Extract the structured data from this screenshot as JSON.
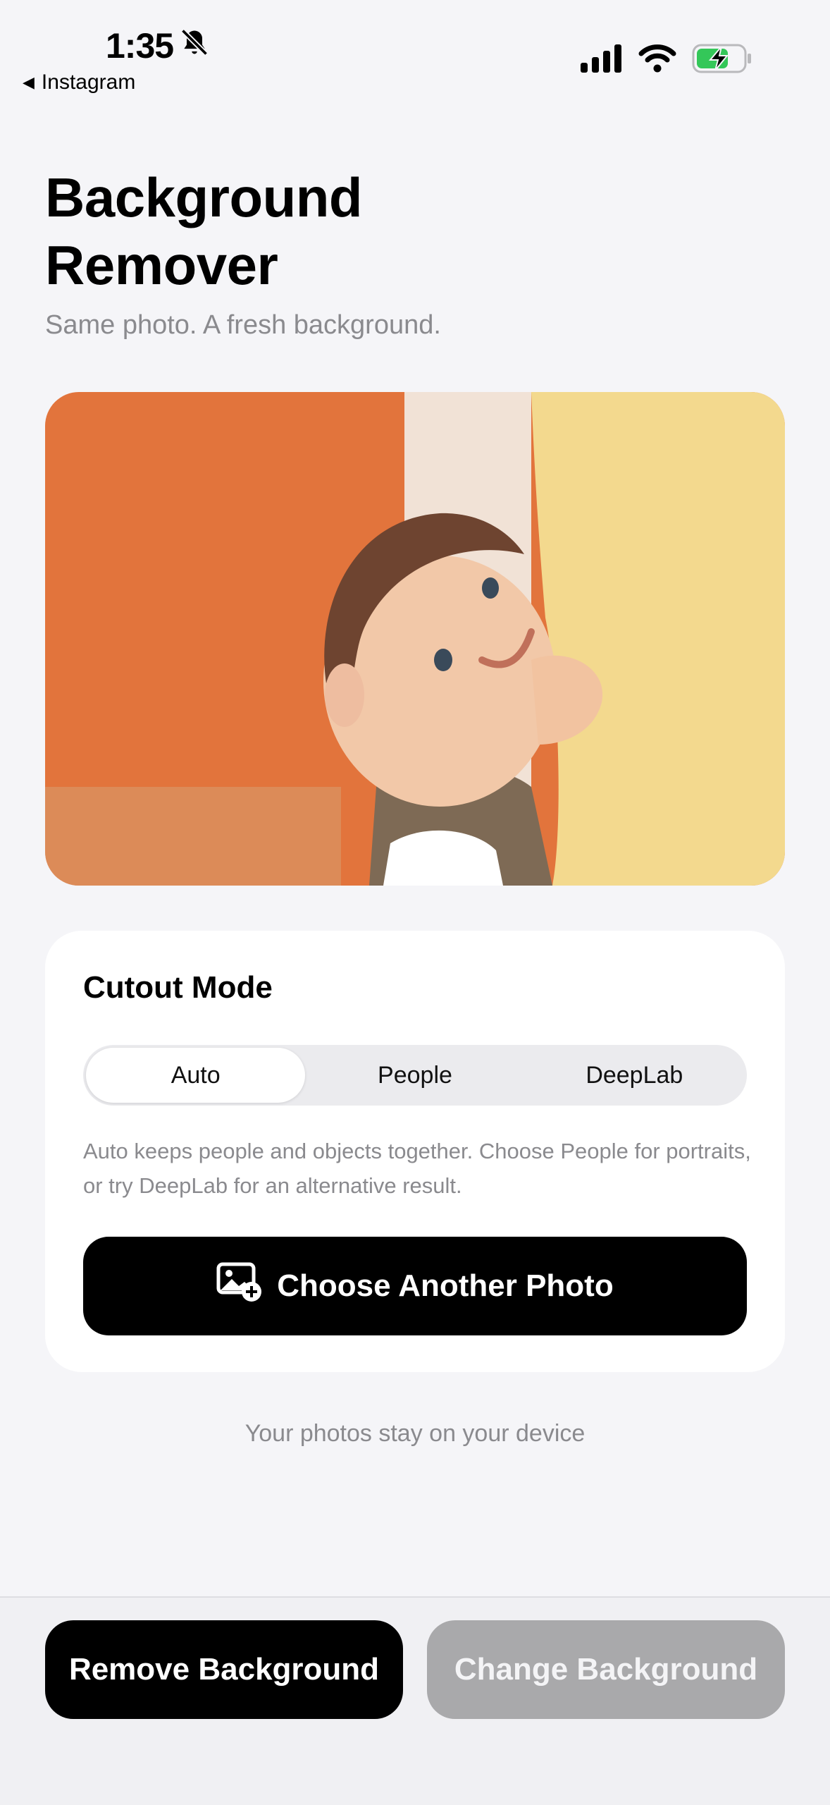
{
  "status_bar": {
    "time": "1:35",
    "back_app": "Instagram",
    "icons": [
      "bell-slash-icon",
      "cellular-signal-icon",
      "wifi-icon",
      "battery-charging-icon"
    ]
  },
  "header": {
    "title": "Background Remover",
    "subtitle": "Same photo. A fresh background."
  },
  "photo": {
    "colors": {
      "left_wall": "#e2743c",
      "right_wall": "#f3d98e"
    }
  },
  "cutout": {
    "title": "Cutout Mode",
    "modes": [
      "Auto",
      "People",
      "DeepLab"
    ],
    "selected": "Auto",
    "description": "Auto keeps people and objects together. Choose People for portraits, or try DeepLab for an alternative result.",
    "choose_label": "Choose Another Photo",
    "choose_icon": "photo-add-icon"
  },
  "footnote": "Your photos stay on your device",
  "bottom": {
    "remove_label": "Remove Background",
    "change_label": "Change Background"
  },
  "colors": {
    "background": "#f5f5f8",
    "primary": "#000000",
    "disabled": "#a9a9ab",
    "secondary_text": "#8a8a8e",
    "battery_green": "#34c759"
  }
}
